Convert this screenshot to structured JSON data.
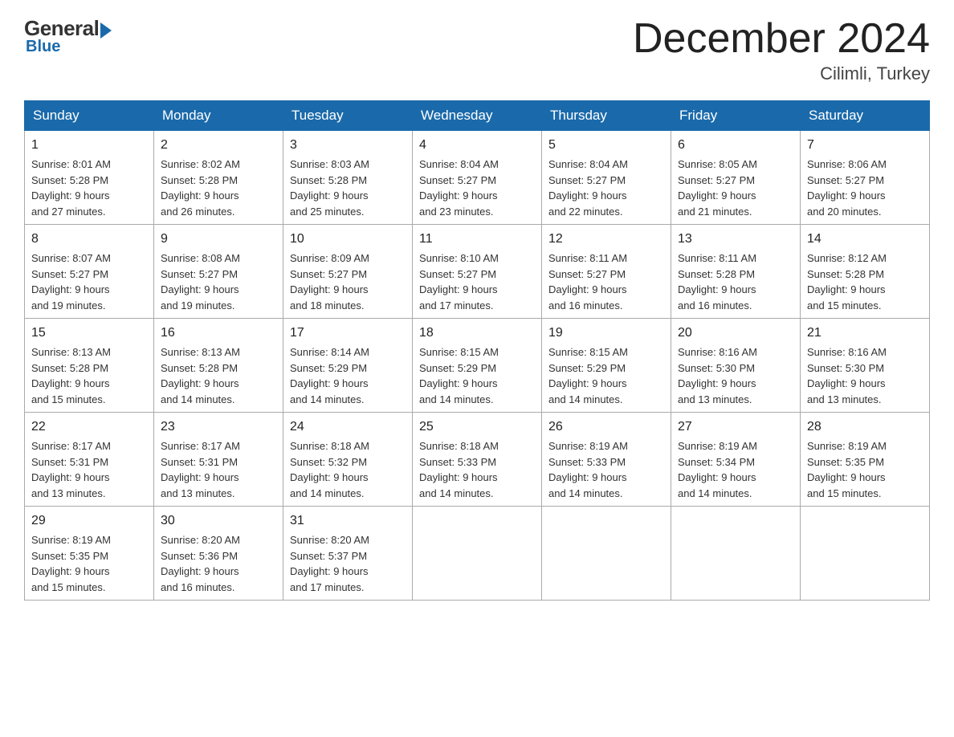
{
  "logo": {
    "general": "General",
    "blue": "Blue"
  },
  "title": {
    "month": "December 2024",
    "location": "Cilimli, Turkey"
  },
  "weekdays": [
    "Sunday",
    "Monday",
    "Tuesday",
    "Wednesday",
    "Thursday",
    "Friday",
    "Saturday"
  ],
  "weeks": [
    [
      {
        "day": "1",
        "info": "Sunrise: 8:01 AM\nSunset: 5:28 PM\nDaylight: 9 hours\nand 27 minutes."
      },
      {
        "day": "2",
        "info": "Sunrise: 8:02 AM\nSunset: 5:28 PM\nDaylight: 9 hours\nand 26 minutes."
      },
      {
        "day": "3",
        "info": "Sunrise: 8:03 AM\nSunset: 5:28 PM\nDaylight: 9 hours\nand 25 minutes."
      },
      {
        "day": "4",
        "info": "Sunrise: 8:04 AM\nSunset: 5:27 PM\nDaylight: 9 hours\nand 23 minutes."
      },
      {
        "day": "5",
        "info": "Sunrise: 8:04 AM\nSunset: 5:27 PM\nDaylight: 9 hours\nand 22 minutes."
      },
      {
        "day": "6",
        "info": "Sunrise: 8:05 AM\nSunset: 5:27 PM\nDaylight: 9 hours\nand 21 minutes."
      },
      {
        "day": "7",
        "info": "Sunrise: 8:06 AM\nSunset: 5:27 PM\nDaylight: 9 hours\nand 20 minutes."
      }
    ],
    [
      {
        "day": "8",
        "info": "Sunrise: 8:07 AM\nSunset: 5:27 PM\nDaylight: 9 hours\nand 19 minutes."
      },
      {
        "day": "9",
        "info": "Sunrise: 8:08 AM\nSunset: 5:27 PM\nDaylight: 9 hours\nand 19 minutes."
      },
      {
        "day": "10",
        "info": "Sunrise: 8:09 AM\nSunset: 5:27 PM\nDaylight: 9 hours\nand 18 minutes."
      },
      {
        "day": "11",
        "info": "Sunrise: 8:10 AM\nSunset: 5:27 PM\nDaylight: 9 hours\nand 17 minutes."
      },
      {
        "day": "12",
        "info": "Sunrise: 8:11 AM\nSunset: 5:27 PM\nDaylight: 9 hours\nand 16 minutes."
      },
      {
        "day": "13",
        "info": "Sunrise: 8:11 AM\nSunset: 5:28 PM\nDaylight: 9 hours\nand 16 minutes."
      },
      {
        "day": "14",
        "info": "Sunrise: 8:12 AM\nSunset: 5:28 PM\nDaylight: 9 hours\nand 15 minutes."
      }
    ],
    [
      {
        "day": "15",
        "info": "Sunrise: 8:13 AM\nSunset: 5:28 PM\nDaylight: 9 hours\nand 15 minutes."
      },
      {
        "day": "16",
        "info": "Sunrise: 8:13 AM\nSunset: 5:28 PM\nDaylight: 9 hours\nand 14 minutes."
      },
      {
        "day": "17",
        "info": "Sunrise: 8:14 AM\nSunset: 5:29 PM\nDaylight: 9 hours\nand 14 minutes."
      },
      {
        "day": "18",
        "info": "Sunrise: 8:15 AM\nSunset: 5:29 PM\nDaylight: 9 hours\nand 14 minutes."
      },
      {
        "day": "19",
        "info": "Sunrise: 8:15 AM\nSunset: 5:29 PM\nDaylight: 9 hours\nand 14 minutes."
      },
      {
        "day": "20",
        "info": "Sunrise: 8:16 AM\nSunset: 5:30 PM\nDaylight: 9 hours\nand 13 minutes."
      },
      {
        "day": "21",
        "info": "Sunrise: 8:16 AM\nSunset: 5:30 PM\nDaylight: 9 hours\nand 13 minutes."
      }
    ],
    [
      {
        "day": "22",
        "info": "Sunrise: 8:17 AM\nSunset: 5:31 PM\nDaylight: 9 hours\nand 13 minutes."
      },
      {
        "day": "23",
        "info": "Sunrise: 8:17 AM\nSunset: 5:31 PM\nDaylight: 9 hours\nand 13 minutes."
      },
      {
        "day": "24",
        "info": "Sunrise: 8:18 AM\nSunset: 5:32 PM\nDaylight: 9 hours\nand 14 minutes."
      },
      {
        "day": "25",
        "info": "Sunrise: 8:18 AM\nSunset: 5:33 PM\nDaylight: 9 hours\nand 14 minutes."
      },
      {
        "day": "26",
        "info": "Sunrise: 8:19 AM\nSunset: 5:33 PM\nDaylight: 9 hours\nand 14 minutes."
      },
      {
        "day": "27",
        "info": "Sunrise: 8:19 AM\nSunset: 5:34 PM\nDaylight: 9 hours\nand 14 minutes."
      },
      {
        "day": "28",
        "info": "Sunrise: 8:19 AM\nSunset: 5:35 PM\nDaylight: 9 hours\nand 15 minutes."
      }
    ],
    [
      {
        "day": "29",
        "info": "Sunrise: 8:19 AM\nSunset: 5:35 PM\nDaylight: 9 hours\nand 15 minutes."
      },
      {
        "day": "30",
        "info": "Sunrise: 8:20 AM\nSunset: 5:36 PM\nDaylight: 9 hours\nand 16 minutes."
      },
      {
        "day": "31",
        "info": "Sunrise: 8:20 AM\nSunset: 5:37 PM\nDaylight: 9 hours\nand 17 minutes."
      },
      null,
      null,
      null,
      null
    ]
  ]
}
